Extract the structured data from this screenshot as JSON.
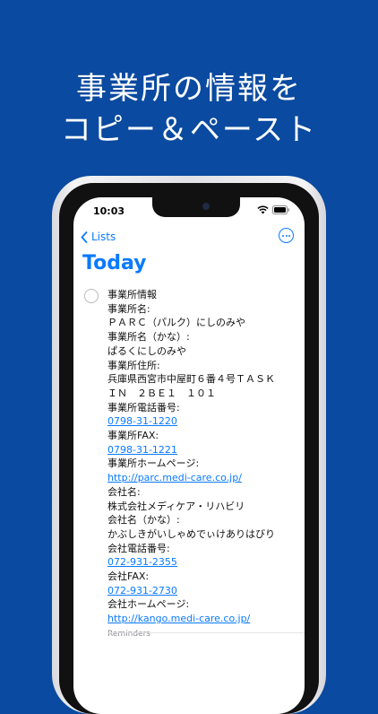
{
  "headline": {
    "line1": "事業所の情報を",
    "line2": "コピー＆ペースト"
  },
  "status_bar": {
    "time": "10:03"
  },
  "nav": {
    "back_label": "Lists"
  },
  "list": {
    "title": "Today"
  },
  "reminder": {
    "lines": [
      {
        "text": "事業所情報"
      },
      {
        "text": "事業所名:"
      },
      {
        "text": "ＰＡＲＣ（パルク）にしのみや"
      },
      {
        "text": "事業所名（かな）:"
      },
      {
        "text": "ぱるくにしのみや"
      },
      {
        "text": "事業所住所:"
      },
      {
        "text": "兵庫県西宮市中屋町６番４号ＴＡＳＫ"
      },
      {
        "text": "ＩＮ　２ＢＥ１　１０１"
      },
      {
        "text": "事業所電話番号:"
      },
      {
        "text": "0798-31-1220",
        "link": true
      },
      {
        "text": "事業所FAX:"
      },
      {
        "text": "0798-31-1221",
        "link": true
      },
      {
        "text": "事業所ホームページ:"
      },
      {
        "text": "http://parc.medi-care.co.jp/",
        "link": true
      },
      {
        "text": "会社名:"
      },
      {
        "text": "株式会社メディケア・リハビリ"
      },
      {
        "text": "会社名（かな）:"
      },
      {
        "text": "かぶしきがいしゃめでぃけありはびり"
      },
      {
        "text": "会社電話番号:"
      },
      {
        "text": "072-931-2355",
        "link": true
      },
      {
        "text": "会社FAX:"
      },
      {
        "text": "072-931-2730",
        "link": true
      },
      {
        "text": "会社ホームページ:"
      },
      {
        "text": "http://kango.medi-care.co.jp/",
        "link": true
      }
    ],
    "list_tag": "Reminders"
  },
  "colors": {
    "background": "#0a4aa0",
    "accent": "#0a7aff",
    "link": "#0a7aff"
  },
  "icons": [
    "chevron-left-icon",
    "more-icon",
    "wifi-icon",
    "battery-icon",
    "checkbox-icon"
  ]
}
